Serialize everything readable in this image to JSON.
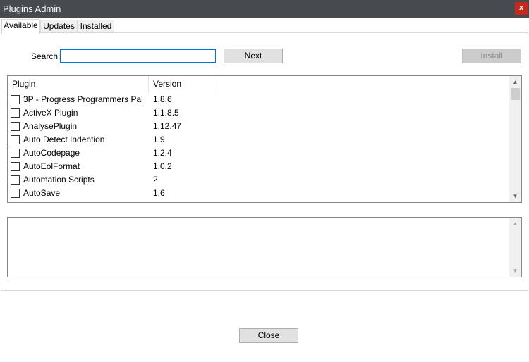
{
  "window": {
    "title": "Plugins Admin",
    "close_glyph": "x"
  },
  "tabs": [
    {
      "label": "Available",
      "active": true
    },
    {
      "label": "Updates",
      "active": false
    },
    {
      "label": "Installed",
      "active": false
    }
  ],
  "search": {
    "label": "Search:",
    "value": "",
    "placeholder": ""
  },
  "buttons": {
    "next": "Next",
    "install": "Install",
    "close": "Close"
  },
  "list": {
    "columns": [
      "Plugin",
      "Version"
    ],
    "rows": [
      {
        "name": "3P - Progress Programmers Pal",
        "version": "1.8.6",
        "checked": false
      },
      {
        "name": "ActiveX Plugin",
        "version": "1.1.8.5",
        "checked": false
      },
      {
        "name": "AnalysePlugin",
        "version": "1.12.47",
        "checked": false
      },
      {
        "name": "Auto Detect Indention",
        "version": "1.9",
        "checked": false
      },
      {
        "name": "AutoCodepage",
        "version": "1.2.4",
        "checked": false
      },
      {
        "name": "AutoEolFormat",
        "version": "1.0.2",
        "checked": false
      },
      {
        "name": "Automation Scripts",
        "version": "2",
        "checked": false
      },
      {
        "name": "AutoSave",
        "version": "1.6",
        "checked": false
      }
    ]
  },
  "description": {
    "text": ""
  },
  "icons": {
    "scroll_up": "scroll-up-arrow-icon",
    "scroll_down": "scroll-down-arrow-icon"
  },
  "colors": {
    "titlebar": "#474a4e",
    "close_button": "#c42b1c",
    "focus_border": "#0078d7"
  }
}
